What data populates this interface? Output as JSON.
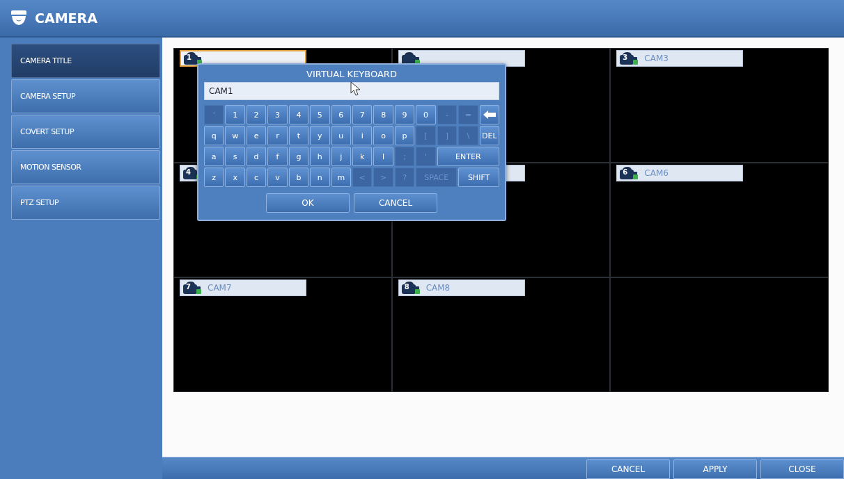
{
  "header": {
    "title": "CAMERA"
  },
  "sidebar": {
    "items": [
      {
        "label": "CAMERA TITLE",
        "selected": true
      },
      {
        "label": "CAMERA SETUP",
        "selected": false
      },
      {
        "label": "COVERT SETUP",
        "selected": false
      },
      {
        "label": "MOTION SENSOR",
        "selected": false
      },
      {
        "label": "PTZ SETUP",
        "selected": false
      }
    ]
  },
  "cameras": [
    {
      "number": "1",
      "selected": true
    },
    {
      "selected": false
    },
    {
      "number": "3",
      "title": "CAM3",
      "selected": false
    },
    {
      "number": "4",
      "selected": false
    },
    {
      "kind": "covered",
      "selected": false
    },
    {
      "number": "6",
      "title": "CAM6",
      "selected": false
    },
    {
      "number": "7",
      "title": "CAM7",
      "selected": false
    },
    {
      "number": "8",
      "title": "CAM8",
      "selected": false
    },
    {
      "kind": "empty"
    }
  ],
  "virtual_keyboard": {
    "title": "VIRTUAL KEYBOARD",
    "value": "CAM1",
    "rows": [
      [
        {
          "label": "'",
          "kind": "key",
          "disabled": true
        },
        {
          "label": "1",
          "kind": "key",
          "disabled": false
        },
        {
          "label": "2",
          "kind": "key",
          "disabled": false
        },
        {
          "label": "3",
          "kind": "key",
          "disabled": false
        },
        {
          "label": "4",
          "kind": "key",
          "disabled": false
        },
        {
          "label": "5",
          "kind": "key",
          "disabled": false
        },
        {
          "label": "6",
          "kind": "key",
          "disabled": false
        },
        {
          "label": "7",
          "kind": "key",
          "disabled": false
        },
        {
          "label": "8",
          "kind": "key",
          "disabled": false
        },
        {
          "label": "9",
          "kind": "key",
          "disabled": false
        },
        {
          "label": "0",
          "kind": "key",
          "disabled": false
        },
        {
          "label": "-",
          "kind": "key",
          "disabled": true
        },
        {
          "label": "=",
          "kind": "key",
          "disabled": true
        },
        {
          "kind": "backspace",
          "disabled": false
        }
      ],
      [
        {
          "label": "q",
          "kind": "key",
          "disabled": false
        },
        {
          "label": "w",
          "kind": "key",
          "disabled": false
        },
        {
          "label": "e",
          "kind": "key",
          "disabled": false
        },
        {
          "label": "r",
          "kind": "key",
          "disabled": false
        },
        {
          "label": "t",
          "kind": "key",
          "disabled": false
        },
        {
          "label": "y",
          "kind": "key",
          "disabled": false
        },
        {
          "label": "u",
          "kind": "key",
          "disabled": false
        },
        {
          "label": "i",
          "kind": "key",
          "disabled": false
        },
        {
          "label": "o",
          "kind": "key",
          "disabled": false
        },
        {
          "label": "p",
          "kind": "key",
          "disabled": false
        },
        {
          "label": "[",
          "kind": "key",
          "disabled": true
        },
        {
          "label": "]",
          "kind": "key",
          "disabled": true
        },
        {
          "label": "\\",
          "kind": "key",
          "disabled": true
        },
        {
          "label": "DEL",
          "kind": "key",
          "disabled": false
        }
      ],
      [
        {
          "label": "a",
          "kind": "key",
          "disabled": false
        },
        {
          "label": "s",
          "kind": "key",
          "disabled": false
        },
        {
          "label": "d",
          "kind": "key",
          "disabled": false
        },
        {
          "label": "f",
          "kind": "key",
          "disabled": false
        },
        {
          "label": "g",
          "kind": "key",
          "disabled": false
        },
        {
          "label": "h",
          "kind": "key",
          "disabled": false
        },
        {
          "label": "j",
          "kind": "key",
          "disabled": false
        },
        {
          "label": "k",
          "kind": "key",
          "disabled": false
        },
        {
          "label": "l",
          "kind": "key",
          "disabled": false
        },
        {
          "label": ";",
          "kind": "key",
          "disabled": true
        },
        {
          "label": "'",
          "kind": "key",
          "disabled": true
        },
        {
          "label": "ENTER",
          "kind": "wider",
          "disabled": false
        }
      ],
      [
        {
          "label": "z",
          "kind": "key",
          "disabled": false
        },
        {
          "label": "x",
          "kind": "key",
          "disabled": false
        },
        {
          "label": "c",
          "kind": "key",
          "disabled": false
        },
        {
          "label": "v",
          "kind": "key",
          "disabled": false
        },
        {
          "label": "b",
          "kind": "key",
          "disabled": false
        },
        {
          "label": "n",
          "kind": "key",
          "disabled": false
        },
        {
          "label": "m",
          "kind": "key",
          "disabled": false
        },
        {
          "label": "<",
          "kind": "key",
          "disabled": true
        },
        {
          "label": ">",
          "kind": "key",
          "disabled": true
        },
        {
          "label": "?",
          "kind": "key",
          "disabled": true
        },
        {
          "label": "SPACE",
          "kind": "wide",
          "disabled": true
        },
        {
          "label": "SHIFT",
          "kind": "wide",
          "disabled": false
        }
      ]
    ],
    "buttons": [
      "OK",
      "CANCEL"
    ]
  },
  "footer_buttons": [
    "CANCEL",
    "APPLY",
    "CLOSE"
  ]
}
